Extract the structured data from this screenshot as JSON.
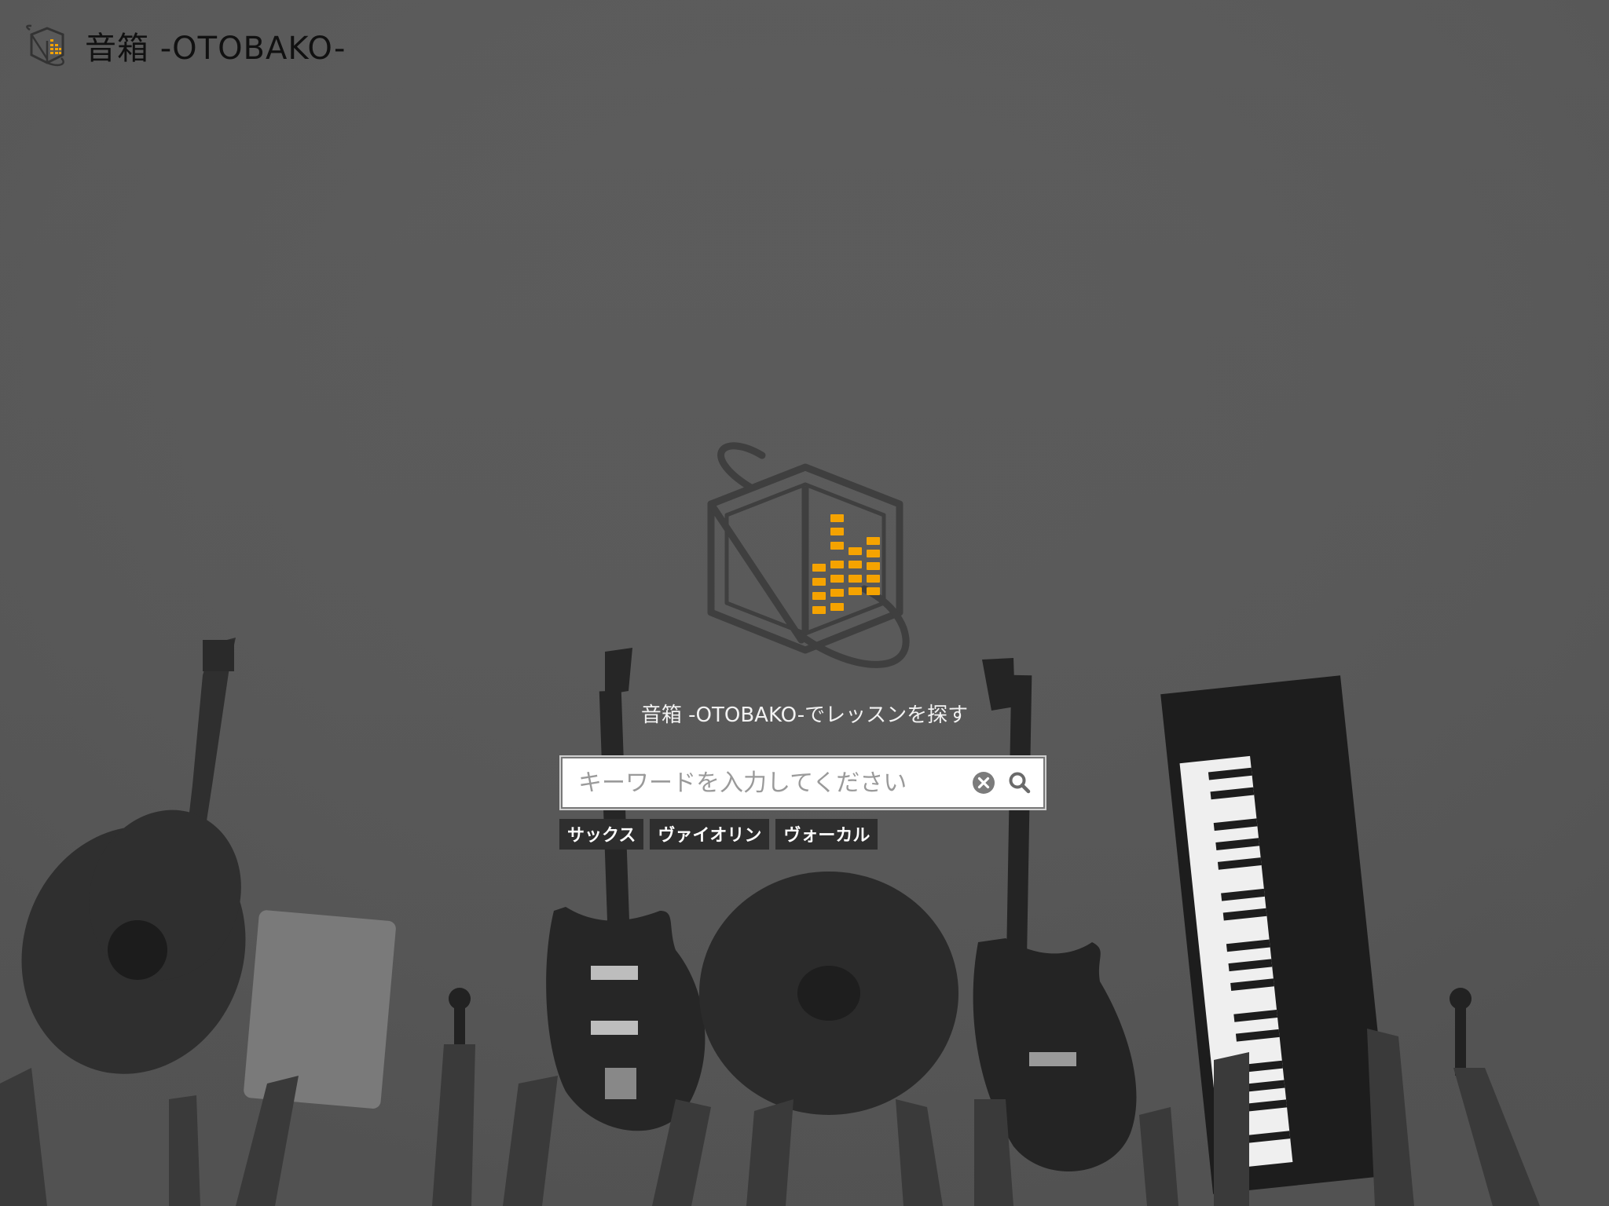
{
  "header": {
    "title": "音箱 -OTOBAKO-",
    "logo_icon": "otobako-logo-icon"
  },
  "hero": {
    "logo_icon": "otobako-cube-logo-icon",
    "tagline": "音箱 -OTOBAKO-でレッスンを探す"
  },
  "search": {
    "placeholder": "キーワードを入力してください",
    "value": "",
    "clear_icon": "clear-circle-icon",
    "search_icon": "search-icon"
  },
  "tags": [
    {
      "label": "サックス"
    },
    {
      "label": "ヴァイオリン"
    },
    {
      "label": "ヴォーカル"
    }
  ],
  "colors": {
    "accent": "#f5a300",
    "background": "#5a5a5a",
    "logo_outline": "#3f3f3f",
    "tag_bg": "#2e2e2e"
  }
}
